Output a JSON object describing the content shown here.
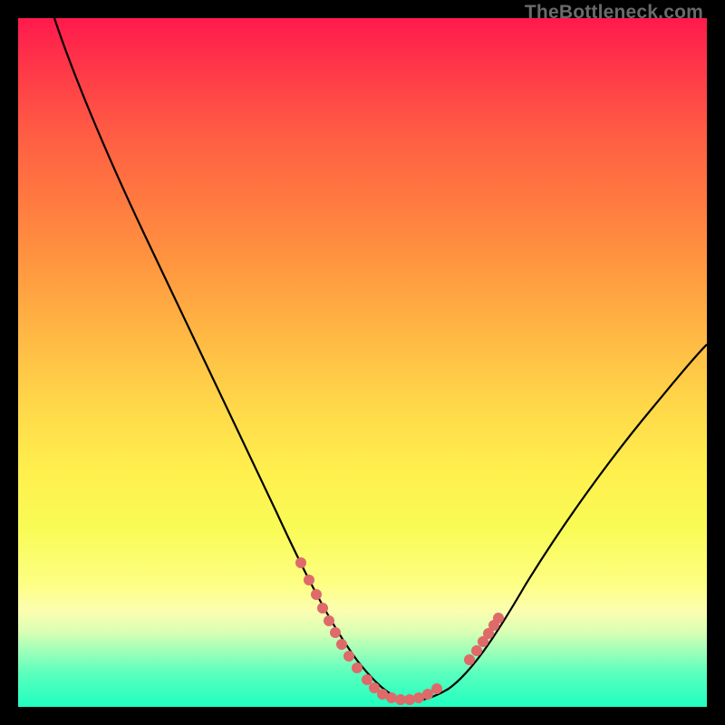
{
  "watermark": "TheBottleneck.com",
  "chart_data": {
    "type": "line",
    "title": "",
    "xlabel": "",
    "ylabel": "",
    "x": [
      0.0,
      0.05,
      0.1,
      0.15,
      0.2,
      0.25,
      0.3,
      0.35,
      0.4,
      0.45,
      0.5,
      0.55,
      0.6,
      0.65,
      0.7,
      0.75,
      0.8,
      0.85,
      0.9,
      0.95,
      1.0
    ],
    "values": [
      1.0,
      0.9,
      0.79,
      0.68,
      0.57,
      0.46,
      0.35,
      0.25,
      0.15,
      0.06,
      0.01,
      0.0,
      0.01,
      0.04,
      0.1,
      0.18,
      0.27,
      0.35,
      0.42,
      0.48,
      0.53
    ],
    "xlim": [
      0,
      1
    ],
    "ylim": [
      0,
      1
    ],
    "note": "x and y are fractions of the plot area; no axis tick labels are shown in the image",
    "markers": {
      "color": "#e06666",
      "clusters": [
        {
          "center_x": 0.41,
          "count": 5
        },
        {
          "center_x": 0.55,
          "count": 7
        },
        {
          "center_x": 0.66,
          "count": 4
        }
      ]
    },
    "curve_stroke": "#000000",
    "curve_width": 2
  }
}
